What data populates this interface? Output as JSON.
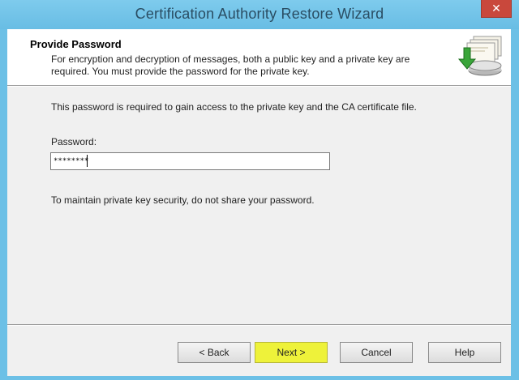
{
  "window": {
    "title": "Certification Authority Restore Wizard",
    "close_glyph": "✕"
  },
  "header": {
    "title": "Provide Password",
    "description": "For encryption and decryption of messages, both a public key and a private key are required. You must provide the password for the private key.",
    "icon": "certificate-restore-icon"
  },
  "content": {
    "intro": "This password is required to gain access to the private key and the CA certificate file.",
    "password_label": "Password:",
    "password_value": "********",
    "security_note": "To maintain private key security, do not share your password."
  },
  "buttons": {
    "back": "< Back",
    "next": "Next >",
    "cancel": "Cancel",
    "help": "Help"
  },
  "colors": {
    "titlebar": "#6cc0e6",
    "close": "#c9483c",
    "next_highlight": "#eef23a"
  }
}
